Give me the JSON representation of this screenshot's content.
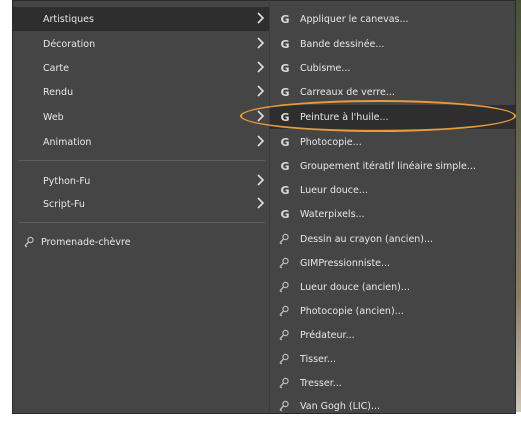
{
  "main_menu": {
    "items": [
      {
        "label": "Artistiques"
      },
      {
        "label": "Décoration"
      },
      {
        "label": "Carte"
      },
      {
        "label": "Rendu"
      },
      {
        "label": "Web"
      },
      {
        "label": "Animation"
      }
    ],
    "scripts": [
      {
        "label": "Python-Fu"
      },
      {
        "label": "Script-Fu"
      }
    ],
    "promenade": {
      "label": "Promenade-chèvre"
    }
  },
  "submenu": {
    "gegl_items": [
      {
        "label": "Appliquer le canevas..."
      },
      {
        "label": "Bande dessinée..."
      },
      {
        "label": "Cubisme..."
      },
      {
        "label": "Carreaux de verre..."
      },
      {
        "label": "Peinture à l'huile..."
      },
      {
        "label": "Photocopie..."
      },
      {
        "label": "Groupement itératif linéaire simple..."
      },
      {
        "label": "Lueur douce..."
      },
      {
        "label": "Waterpixels..."
      }
    ],
    "script_items": [
      {
        "label": "Dessin au crayon (ancien)..."
      },
      {
        "label": "GIMPressionniste..."
      },
      {
        "label": "Lueur douce (ancien)..."
      },
      {
        "label": "Photocopie (ancien)..."
      },
      {
        "label": "Prédateur..."
      },
      {
        "label": "Tisser..."
      },
      {
        "label": "Tresser..."
      },
      {
        "label": "Van Gogh (LIC)..."
      }
    ]
  },
  "icons": {
    "gegl": "G",
    "script": "script-icon",
    "arrow": "chevron-right-icon"
  },
  "colors": {
    "menu_bg": "#454545",
    "highlight": "#2e2e2e",
    "annotation_ellipse": "#e89a3c"
  }
}
